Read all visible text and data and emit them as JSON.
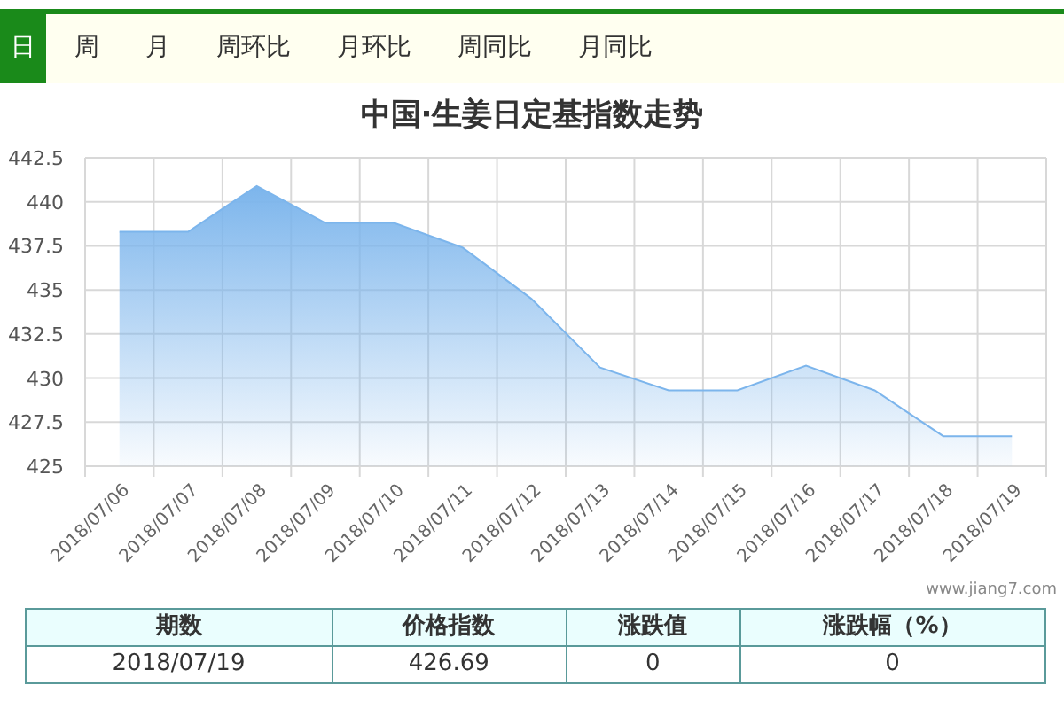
{
  "tabs": [
    {
      "label": "日",
      "selected": true
    },
    {
      "label": "周",
      "selected": false
    },
    {
      "label": "月",
      "selected": false
    },
    {
      "label": "周环比",
      "selected": false
    },
    {
      "label": "月环比",
      "selected": false
    },
    {
      "label": "周同比",
      "selected": false
    },
    {
      "label": "月同比",
      "selected": false
    }
  ],
  "chart": {
    "chart_data": {
      "type": "area",
      "title": "中国·生姜日定基指数走势",
      "categories": [
        "2018/07/06",
        "2018/07/07",
        "2018/07/08",
        "2018/07/09",
        "2018/07/10",
        "2018/07/11",
        "2018/07/12",
        "2018/07/13",
        "2018/07/14",
        "2018/07/15",
        "2018/07/16",
        "2018/07/17",
        "2018/07/18",
        "2018/07/19"
      ],
      "series": [
        {
          "color": "#7cb5ec",
          "values": [
            438.3,
            438.3,
            440.9,
            438.8,
            438.8,
            437.4,
            434.5,
            430.6,
            429.3,
            429.3,
            430.7,
            429.3,
            426.7,
            426.7
          ]
        }
      ],
      "grid": true,
      "ylim": [
        425,
        442.5
      ],
      "yticks": [
        425,
        427.5,
        430,
        432.5,
        435,
        437.5,
        440,
        442.5
      ]
    },
    "credits": "www.jiang7.com"
  },
  "table": {
    "columns": [
      "期数",
      "价格指数",
      "涨跌值",
      "涨跌幅（%）"
    ],
    "rows": [
      [
        "2018/07/19",
        "426.69",
        "0",
        "0"
      ]
    ]
  }
}
